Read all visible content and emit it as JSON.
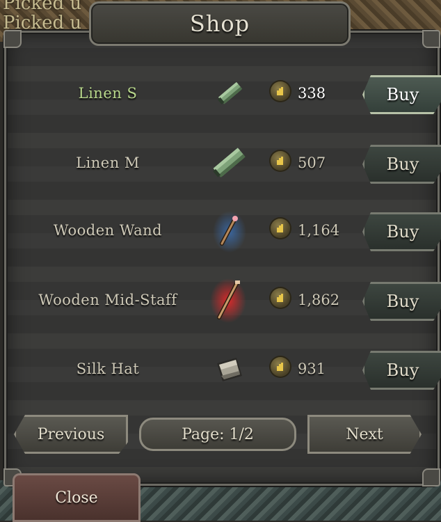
{
  "chat_log": [
    "Picked u",
    "Picked u"
  ],
  "shop": {
    "title": "Shop",
    "items": [
      {
        "name": "Linen S",
        "price": "338",
        "buy_label": "Buy",
        "icon": "linen-cloth-small-icon",
        "selected": true
      },
      {
        "name": "Linen M",
        "price": "507",
        "buy_label": "Buy",
        "icon": "linen-cloth-medium-icon",
        "selected": false
      },
      {
        "name": "Wooden Wand",
        "price": "1,164",
        "buy_label": "Buy",
        "icon": "wooden-wand-icon",
        "selected": false
      },
      {
        "name": "Wooden Mid-Staff",
        "price": "1,862",
        "buy_label": "Buy",
        "icon": "wooden-mid-staff-icon",
        "selected": false
      },
      {
        "name": "Silk Hat",
        "price": "931",
        "buy_label": "Buy",
        "icon": "silk-hat-icon",
        "selected": false
      }
    ],
    "pagination": {
      "previous_label": "Previous",
      "page_label": "Page: 1/2",
      "next_label": "Next"
    },
    "close_label": "Close"
  },
  "colors": {
    "selected_name": "#b9d98c",
    "text": "#cfcab8",
    "gold": "#e8c64a"
  }
}
